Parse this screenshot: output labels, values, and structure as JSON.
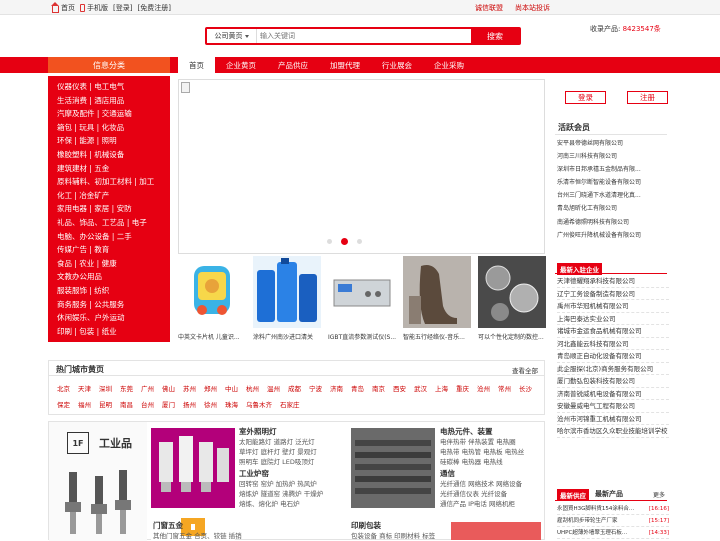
{
  "topbar": {
    "home": "首页",
    "mobile": "手机版",
    "login": "[登录]",
    "register": "[免费注册]",
    "right_links": [
      "诚信联盟",
      "尚本站投诉"
    ]
  },
  "search": {
    "select_label": "公司黄页",
    "placeholder": "输入关键词",
    "button": "搜索"
  },
  "collect": {
    "label": "收录产品:",
    "count": "8423547条"
  },
  "nav": {
    "category_title": "信息分类",
    "items": [
      "首页",
      "企业黄页",
      "产品供应",
      "加盟代理",
      "行业展会",
      "企业采购"
    ]
  },
  "categories": [
    "仪器仪表 | 电工电气",
    "生活消费 | 酒店用品",
    "汽摩及配件 | 交通运输",
    "箱包 | 玩具 | 化妆品",
    "环保 | 能源 | 照明",
    "橡胶塑料 | 机械设备",
    "建筑建材 | 五金",
    "原料辅料、初加工材料 | 加工",
    "化工 | 冶金矿产",
    "家用电器 | 家居 | 安防",
    "礼品、饰品、工艺品 | 电子",
    "电脑、办公设备 | 二手",
    "传媒广告 | 教育",
    "食品 | 农业 | 健康",
    "文教办公用品",
    "服装服饰 | 纺织",
    "商务服务 | 公共服务",
    "休闲娱乐、户外运动",
    "印刷 | 包装 | 纸业"
  ],
  "products": [
    "中英文卡片机 儿童识...",
    "涂料广州南沙进口清关",
    "IGBT直流参数测试仪(S...",
    "智能五行经络仪-音乐...",
    "可以个性化定制的数控..."
  ],
  "hot_cities": {
    "title": "热门城市黄页",
    "more": "查看全部",
    "cities": [
      "北京",
      "天津",
      "深圳",
      "东莞",
      "广州",
      "佛山",
      "苏州",
      "郑州",
      "中山",
      "杭州",
      "温州",
      "成都",
      "宁波",
      "济南",
      "青岛",
      "南京",
      "西安",
      "武汉",
      "上海",
      "重庆",
      "沧州",
      "常州",
      "长沙",
      "保定",
      "福州",
      "昆明",
      "南昌",
      "台州",
      "厦门",
      "扬州",
      "徐州",
      "珠海",
      "乌鲁木齐",
      "石家庄"
    ]
  },
  "floor": {
    "badge": "1F",
    "name": "工业品",
    "blocks": [
      {
        "title": "室外照明灯",
        "lines": [
          "太阳能路灯  道路灯  泛光灯",
          "草坪灯  庭杆灯  壁灯  景观灯",
          "照明车  庭院灯  LED吸顶灯"
        ]
      },
      {
        "title": "工业炉窑",
        "lines": [
          "回转窑  窑炉  加热炉  热风炉",
          "熔炼炉  隧道窑  沸腾炉  干燥炉",
          "熔炼、熔化炉  电石炉"
        ]
      },
      {
        "title": "门窗五金",
        "lines": [
          "其他门窗五金  合页、铰链  插销"
        ]
      },
      {
        "title": "电热元件、装置",
        "lines": [
          "电伴热带  伴热装置  电热圈",
          "电热带  电热管  电热板  电热丝",
          "硅碳棒  电热器  电热线"
        ]
      },
      {
        "title": "通信",
        "lines": [
          "光纤通信  网络技术  网络设备",
          "光纤通信仪表  光纤设备",
          "通信产品  IP电话  网络机柜"
        ]
      },
      {
        "title": "印刷包装",
        "lines": [
          "包装设备  商标  印刷材料  标签"
        ]
      }
    ]
  },
  "right": {
    "login_btn": "登录",
    "register_btn": "注册",
    "active_title": "活跃会员",
    "active_members": [
      "安平县帝德丝网有限公司",
      "河南三川科技有限公司",
      "深圳市日邦承禧五金制品有限...",
      "乐清市恒尔断智能设备有限公司",
      "台州三门晓通下水道清理化真...",
      "青岛旭昕化工有限公司",
      "南通希德照明科技有限公司",
      "广州俊旺升降机械设备有限公司"
    ],
    "newest_tag": "最新入驻企业",
    "newest_companies": [
      "天津德耀翔承科技有限公司",
      "辽宁工务设备制造有限公司",
      "禹州市华冠机械有限公司",
      "上海巴泰达实业公司",
      "诸城市金运食品机械有限公司",
      "河北鑫能云科技有限公司",
      "青岛顺正自动化设备有限公司",
      "此企服探(北京)商务服务有限公司",
      "厦门勤弘包装科技有限公司",
      "济南普锐威机电设备有限公司",
      "安徽曼威电气工程有限公司",
      "沧州市河锦重工机械有限公司",
      "哈尔滨市香坊区久众职业技能培训学校"
    ],
    "supply_tag": "最新供应",
    "supply_title": "最新产品",
    "supply_more": "更多",
    "supply": [
      {
        "name": "永固買H3G脚料貨154涂料合...",
        "date": "[16:16]"
      },
      {
        "name": "雇刮机同步带轮生产厂家",
        "date": "[15:17]"
      },
      {
        "name": "UHPC超薄外墙翠玉理石板...",
        "date": "[14:33]"
      }
    ]
  },
  "colors": {
    "brand": "#e60012",
    "nav_highlight": "#f2521f"
  }
}
